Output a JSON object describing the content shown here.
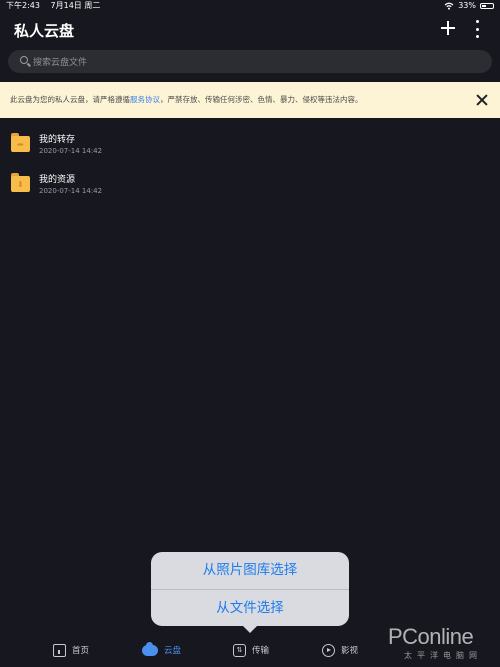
{
  "status_bar": {
    "time": "下午2:43",
    "date": "7月14日 周二",
    "wifi_icon": "wifi-icon",
    "battery": "33%"
  },
  "header": {
    "title": "私人云盘",
    "add_icon": "plus-icon",
    "more_icon": "more-vertical-icon"
  },
  "search": {
    "placeholder": "搜索云盘文件"
  },
  "notice": {
    "text_before": "此云盘为您的私人云盘，请严格遵循",
    "link": "服务协议",
    "text_after": "，严禁存放、传输任何涉密、色情、暴力、侵权等违法内容。",
    "close_icon": "close-icon",
    "background_color": "#fdf4d6",
    "link_color": "#3f82e6"
  },
  "files": [
    {
      "name": "我的转存",
      "date": "2020-07-14 14:42",
      "icon": "folder-icon"
    },
    {
      "name": "我的资源",
      "date": "2020-07-14 14:42",
      "icon": "folder-icon"
    }
  ],
  "action_sheet": {
    "option_photo": "从照片图库选择",
    "option_file": "从文件选择",
    "accent_color": "#1c7cf0"
  },
  "tab_bar": {
    "tabs": [
      {
        "label": "首页",
        "icon": "home-icon"
      },
      {
        "label": "云盘",
        "icon": "cloud-icon",
        "active": true
      },
      {
        "label": "传输",
        "icon": "transfer-icon"
      },
      {
        "label": "影视",
        "icon": "play-icon"
      }
    ],
    "active_color": "#4a90ee"
  },
  "watermark": {
    "brand": "PConline",
    "sub": "太平洋电脑网"
  }
}
